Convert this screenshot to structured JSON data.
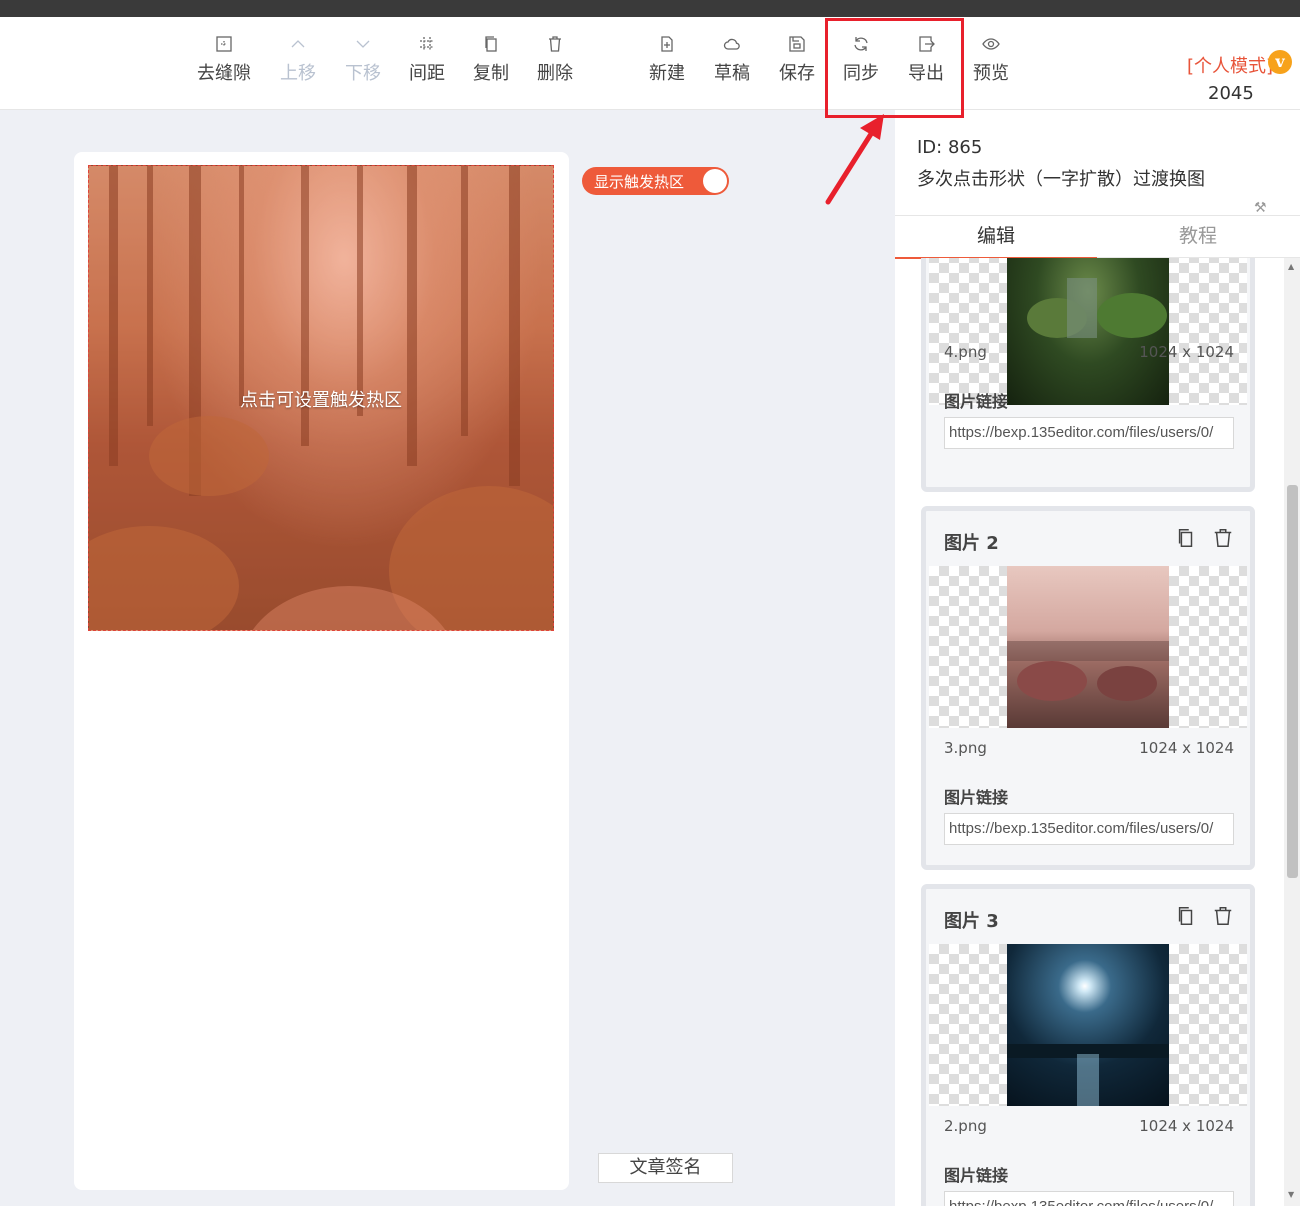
{
  "toolbar": {
    "items": [
      {
        "label": "去缝隙",
        "icon": "remove-gap-icon",
        "enabled": true
      },
      {
        "label": "上移",
        "icon": "chevron-up-icon",
        "enabled": false
      },
      {
        "label": "下移",
        "icon": "chevron-down-icon",
        "enabled": false
      },
      {
        "label": "间距",
        "icon": "spacing-grid-icon",
        "enabled": true
      },
      {
        "label": "复制",
        "icon": "copy-icon",
        "enabled": true
      },
      {
        "label": "删除",
        "icon": "trash-icon",
        "enabled": true
      },
      {
        "label": "新建",
        "icon": "new-file-icon",
        "enabled": true
      },
      {
        "label": "草稿",
        "icon": "cloud-icon",
        "enabled": true
      },
      {
        "label": "保存",
        "icon": "save-icon",
        "enabled": true
      },
      {
        "label": "同步",
        "icon": "sync-icon",
        "enabled": true
      },
      {
        "label": "导出",
        "icon": "export-icon",
        "enabled": true
      },
      {
        "label": "预览",
        "icon": "eye-icon",
        "enabled": true
      }
    ],
    "mode_label": "[个人模式]",
    "vip_badge": "v",
    "count": "2045"
  },
  "canvas": {
    "hotspot_text": "点击可设置触发热区",
    "toggle_label": "显示触发热区",
    "toggle_on": true,
    "signature_button": "文章签名"
  },
  "panel": {
    "id_text": "ID: 865",
    "name": "多次点击形状（一字扩散）过渡换图",
    "tabs": [
      {
        "label": "编辑",
        "active": true
      },
      {
        "label": "教程",
        "active": false
      }
    ],
    "cards": [
      {
        "title": "",
        "filename": "4.png",
        "dimensions": "1024 x 1024",
        "link_label": "图片链接",
        "link": "https://bexp.135editor.com/files/users/0/"
      },
      {
        "title": "图片 2",
        "filename": "3.png",
        "dimensions": "1024 x 1024",
        "link_label": "图片链接",
        "link": "https://bexp.135editor.com/files/users/0/"
      },
      {
        "title": "图片 3",
        "filename": "2.png",
        "dimensions": "1024 x 1024",
        "link_label": "图片链接",
        "link": "https://bexp.135editor.com/files/users/0/"
      }
    ]
  },
  "colors": {
    "accent": "#ee5a3a",
    "highlight": "#e8202c",
    "disabled": "#b9c2d0"
  }
}
